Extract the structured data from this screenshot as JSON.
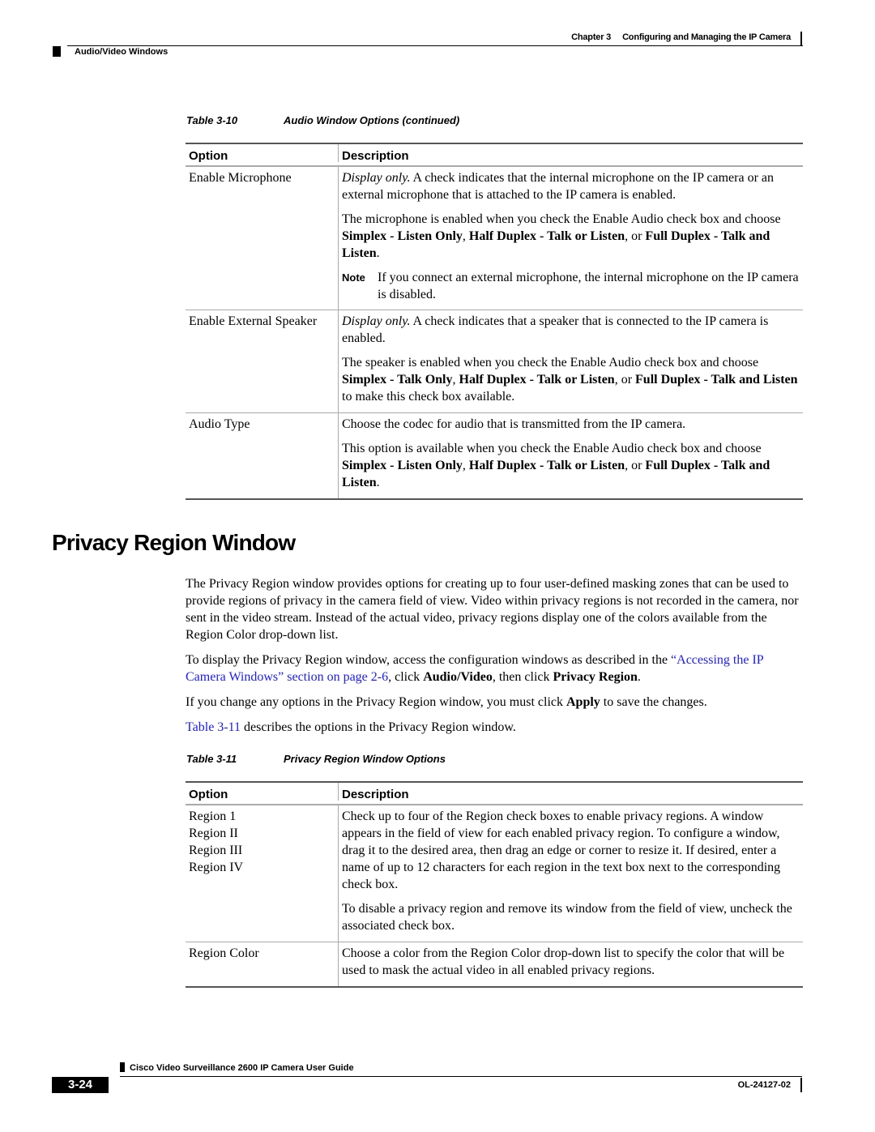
{
  "header": {
    "chapter": "Chapter 3",
    "chapter_title": "Configuring and Managing the IP Camera",
    "section": "Audio/Video Windows"
  },
  "table1": {
    "caption_num": "Table 3-10",
    "caption_title": "Audio Window Options (continued)",
    "col_option": "Option",
    "col_description": "Description",
    "rows": [
      {
        "option": "Enable Microphone",
        "p1_italic": "Display only.",
        "p1_rest": " A check indicates that the internal microphone on the IP camera or an external microphone that is attached to the IP camera is enabled.",
        "p2_pre": "The microphone is enabled when you check the Enable Audio check box and choose ",
        "p2_b1": "Simplex - Listen Only",
        "p2_s1": ", ",
        "p2_b2": "Half Duplex - Talk or Listen",
        "p2_s2": ", or ",
        "p2_b3": "Full Duplex - Talk and Listen",
        "p2_end": ".",
        "note_label": "Note",
        "note_text": "If you connect an external microphone, the internal microphone on the IP camera is disabled."
      },
      {
        "option": "Enable External Speaker",
        "p1_italic": "Display only.",
        "p1_rest": " A check indicates that a speaker that is connected to the IP camera is enabled.",
        "p2_pre": "The speaker is enabled when you check the Enable Audio check box and choose ",
        "p2_b1": "Simplex - Talk Only",
        "p2_s1": ", ",
        "p2_b2": "Half Duplex - Talk or Listen",
        "p2_s2": ", or ",
        "p2_b3": "Full Duplex - Talk and Listen",
        "p2_end": " to make this check box available."
      },
      {
        "option": "Audio Type",
        "p1": "Choose the codec for audio that is transmitted from the IP camera.",
        "p2_pre": "This option is available when you check the Enable Audio check box and choose ",
        "p2_b1": "Simplex - Listen Only",
        "p2_s1": ", ",
        "p2_b2": "Half Duplex - Talk or Listen",
        "p2_s2": ", or ",
        "p2_b3": "Full Duplex - Talk and Listen",
        "p2_end": "."
      }
    ]
  },
  "section": {
    "heading": "Privacy Region Window",
    "para1": "The Privacy Region window provides options for creating up to four user-defined masking zones that can be used to provide regions of privacy in the camera field of view. Video within privacy regions is not recorded in the camera, nor sent in the video stream. Instead of the actual video, privacy regions display one of the colors available from the Region Color drop-down list.",
    "para2_pre": "To display the Privacy Region window, access the configuration windows as described in the ",
    "para2_link": "“Accessing the IP Camera Windows” section on page 2-6",
    "para2_mid": ", click ",
    "para2_b1": "Audio/Video",
    "para2_mid2": ", then click ",
    "para2_b2": "Privacy Region",
    "para2_end": ".",
    "para3_pre": "If you change any options in the Privacy Region window, you must click ",
    "para3_b": "Apply",
    "para3_end": " to save the changes.",
    "para4_link": "Table 3-11",
    "para4_rest": " describes the options in the Privacy Region window."
  },
  "table2": {
    "caption_num": "Table 3-11",
    "caption_title": "Privacy Region Window Options",
    "col_option": "Option",
    "col_description": "Description",
    "rows": [
      {
        "options": [
          "Region 1",
          "Region II",
          "Region III",
          "Region IV"
        ],
        "p1": " Check up to four of the Region check boxes to enable privacy regions. A window appears in the field of view for each enabled privacy region. To configure a window, drag it to the desired area, then drag an edge or corner to resize it. If desired, enter a name of up to 12 characters for each region in the text box next to the corresponding check box.",
        "p2": "To disable a privacy region and remove its window from the field of view, uncheck the associated check box."
      },
      {
        "option": "Region Color",
        "p1": " Choose a color from the Region Color drop-down list to specify the color that will be used to mask the actual video in all enabled privacy regions."
      }
    ]
  },
  "footer": {
    "guide_title": "Cisco Video Surveillance 2600 IP Camera User Guide",
    "page_number": "3-24",
    "doc_number": "OL-24127-02"
  }
}
